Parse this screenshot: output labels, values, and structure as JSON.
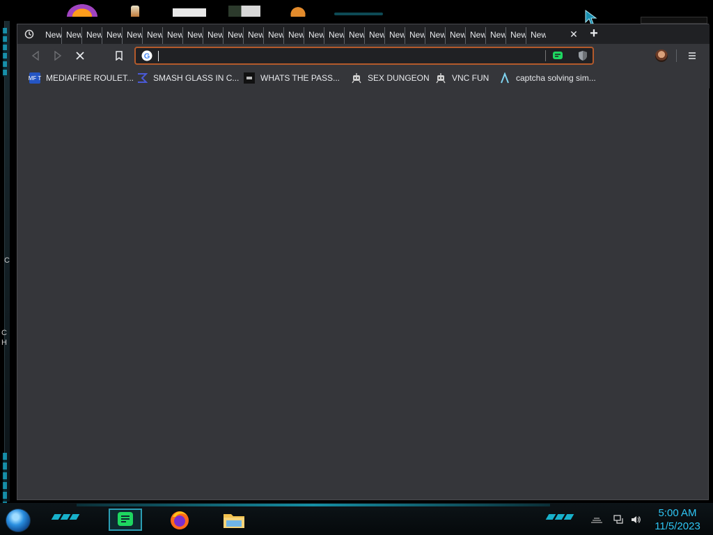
{
  "desktop": {
    "edge_texts": [
      "C",
      "C",
      "H"
    ]
  },
  "browser": {
    "tabs": [
      {
        "label": "New"
      },
      {
        "label": "New"
      },
      {
        "label": "New"
      },
      {
        "label": "New"
      },
      {
        "label": "New"
      },
      {
        "label": "New"
      },
      {
        "label": "New"
      },
      {
        "label": "New"
      },
      {
        "label": "New"
      },
      {
        "label": "New"
      },
      {
        "label": "New"
      },
      {
        "label": "New"
      },
      {
        "label": "New"
      },
      {
        "label": "New"
      },
      {
        "label": "New"
      },
      {
        "label": "New"
      },
      {
        "label": "New"
      },
      {
        "label": "New"
      },
      {
        "label": "New"
      },
      {
        "label": "New"
      },
      {
        "label": "New"
      },
      {
        "label": "New"
      },
      {
        "label": "New"
      },
      {
        "label": "New"
      },
      {
        "label": "New"
      }
    ],
    "tab_close_glyph": "✕",
    "new_tab_glyph": "+",
    "address_bar": {
      "value": "",
      "placeholder": ""
    },
    "bookmarks": [
      {
        "label": "MEDIAFIRE ROULET...",
        "icon": "mediafire-icon"
      },
      {
        "label": "SMASH GLASS IN C...",
        "icon": "sigma-icon"
      },
      {
        "label": "WHATS THE PASS...",
        "icon": "dark-site-icon"
      },
      {
        "label": "SEX DUNGEON",
        "icon": "robot-icon"
      },
      {
        "label": "VNC FUN",
        "icon": "robot-icon"
      },
      {
        "label": "captcha solving sim...",
        "icon": "lambda-icon"
      }
    ],
    "mediafire_icon_text": "MF T",
    "url_focus_color": "#b45a2b"
  },
  "taskbar": {
    "time": "5:00 AM",
    "date": "11/5/2023",
    "accent_color": "#19c3e0",
    "clock_color": "#2ec6f5",
    "apps": [
      "notes-app-icon",
      "firefox-icon",
      "file-explorer-icon"
    ]
  }
}
